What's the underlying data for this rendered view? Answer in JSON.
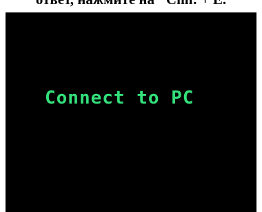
{
  "caption": {
    "text": "ответ, нажмите на \"Cnn: + Е."
  },
  "device_screen": {
    "message": "Connect to PC",
    "background_color": "#000000",
    "text_color": "#33e07a"
  }
}
